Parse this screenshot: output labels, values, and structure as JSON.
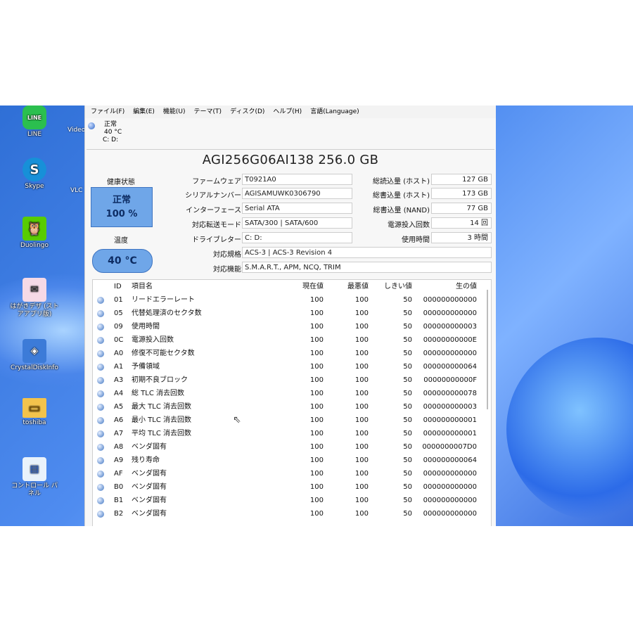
{
  "desktop": {
    "icons": [
      {
        "label": "LINE",
        "glyph": "LINE"
      },
      {
        "label": "Skype",
        "glyph": "S"
      },
      {
        "label": "Duolingo",
        "glyph": "🦉"
      },
      {
        "label": "はがきデザ (ストアアプリ版)",
        "glyph": "✉"
      },
      {
        "label": "CrystalDiskInfo",
        "glyph": "◈"
      },
      {
        "label": "toshiba",
        "glyph": "▭"
      },
      {
        "label": "コントロール パネル",
        "glyph": "▤"
      }
    ],
    "edge_labels": [
      "Video",
      "VLC"
    ]
  },
  "app": {
    "menu": [
      "ファイル(F)",
      "編集(E)",
      "機能(U)",
      "テーマ(T)",
      "ディスク(D)",
      "ヘルプ(H)",
      "言語(Language)"
    ],
    "disk_tab": {
      "status": "正常",
      "temp": "40 °C",
      "drive": "C: D:"
    },
    "model": "AGI256G06AI138 256.0 GB",
    "health": {
      "label": "健康状態",
      "status": "正常",
      "percent": "100 %"
    },
    "temperature": {
      "label": "温度",
      "value": "40 °C"
    },
    "left_fields": [
      {
        "label": "ファームウェア",
        "value": "T0921A0"
      },
      {
        "label": "シリアルナンバー",
        "value": "AGISAMUWK0306790"
      },
      {
        "label": "インターフェース",
        "value": "Serial ATA"
      },
      {
        "label": "対応転送モード",
        "value": "SATA/300 | SATA/600"
      },
      {
        "label": "ドライブレター",
        "value": "C: D:"
      }
    ],
    "right_fields": [
      {
        "label": "総読込量 (ホスト)",
        "value": "127 GB"
      },
      {
        "label": "総書込量 (ホスト)",
        "value": "173 GB"
      },
      {
        "label": "総書込量 (NAND)",
        "value": "77 GB"
      },
      {
        "label": "電源投入回数",
        "value": "14 回"
      },
      {
        "label": "使用時間",
        "value": "3 時間"
      }
    ],
    "wide_fields": [
      {
        "label": "対応規格",
        "value": "ACS-3 | ACS-3 Revision 4"
      },
      {
        "label": "対応機能",
        "value": "S.M.A.R.T., APM, NCQ, TRIM"
      }
    ],
    "smart_table": {
      "headers": [
        "ID",
        "項目名",
        "現在値",
        "最悪値",
        "しきい値",
        "生の値"
      ],
      "rows": [
        [
          "01",
          "リードエラーレート",
          "100",
          "100",
          "50",
          "000000000000"
        ],
        [
          "05",
          "代替処理済のセクタ数",
          "100",
          "100",
          "50",
          "000000000000"
        ],
        [
          "09",
          "使用時間",
          "100",
          "100",
          "50",
          "000000000003"
        ],
        [
          "0C",
          "電源投入回数",
          "100",
          "100",
          "50",
          "00000000000E"
        ],
        [
          "A0",
          "修復不可能セクタ数",
          "100",
          "100",
          "50",
          "000000000000"
        ],
        [
          "A1",
          "予備領域",
          "100",
          "100",
          "50",
          "000000000064"
        ],
        [
          "A3",
          "初期不良ブロック",
          "100",
          "100",
          "50",
          "00000000000F"
        ],
        [
          "A4",
          "総 TLC 消去回数",
          "100",
          "100",
          "50",
          "000000000078"
        ],
        [
          "A5",
          "最大 TLC 消去回数",
          "100",
          "100",
          "50",
          "000000000003"
        ],
        [
          "A6",
          "最小 TLC 消去回数",
          "100",
          "100",
          "50",
          "000000000001"
        ],
        [
          "A7",
          "平均 TLC 消去回数",
          "100",
          "100",
          "50",
          "000000000001"
        ],
        [
          "A8",
          "ベンダ固有",
          "100",
          "100",
          "50",
          "0000000007D0"
        ],
        [
          "A9",
          "残り寿命",
          "100",
          "100",
          "50",
          "000000000064"
        ],
        [
          "AF",
          "ベンダ固有",
          "100",
          "100",
          "50",
          "000000000000"
        ],
        [
          "B0",
          "ベンダ固有",
          "100",
          "100",
          "50",
          "000000000000"
        ],
        [
          "B1",
          "ベンダ固有",
          "100",
          "100",
          "50",
          "000000000000"
        ],
        [
          "B2",
          "ベンダ固有",
          "100",
          "100",
          "50",
          "000000000000"
        ]
      ]
    }
  },
  "colors": {
    "health_fill": "#6fa6e8",
    "desktop_blue": "#2f6fd6"
  }
}
